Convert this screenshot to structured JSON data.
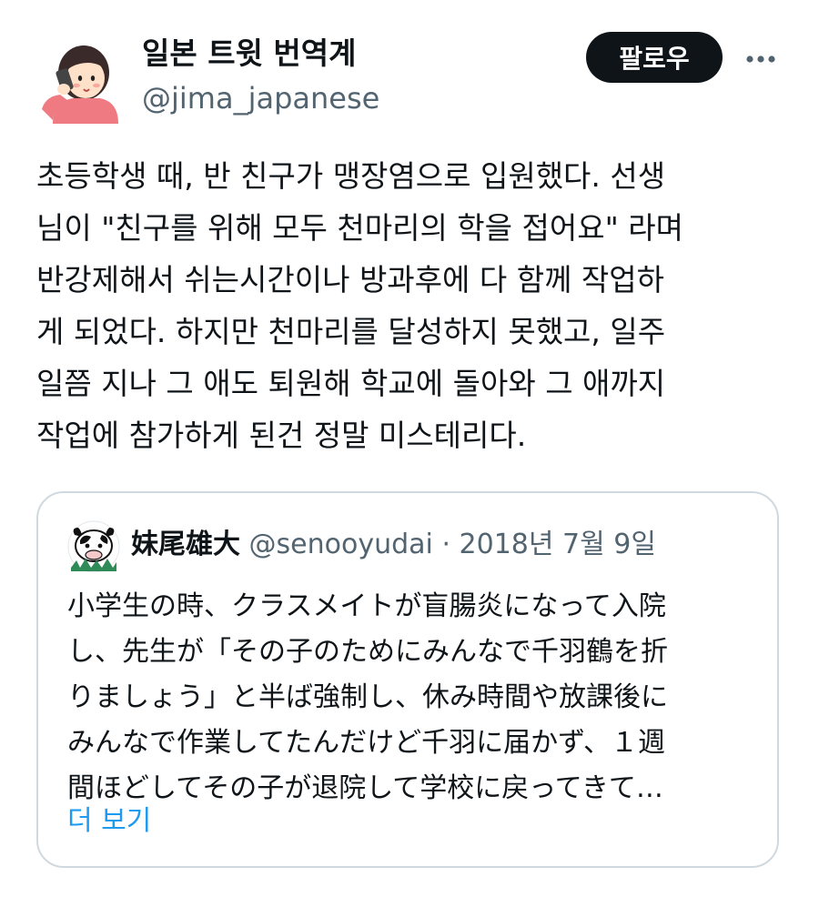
{
  "author": {
    "display_name": "일본 트윗 번역계",
    "handle": "@jima_japanese",
    "avatar_icon": "girl-on-phone-avatar"
  },
  "actions": {
    "follow_label": "팔로우",
    "more_icon": "more-dots-icon"
  },
  "tweet": {
    "lines": [
      "초등학생 때, 반 친구가 맹장염으로 입원했다. 선생",
      "님이 \"친구를 위해 모두 천마리의 학을 접어요\" 라며",
      "반강제해서 쉬는시간이나 방과후에 다 함께 작업하",
      "게 되었다. 하지만 천마리를 달성하지 못했고, 일주",
      "일쯤 지나 그 애도 퇴원해 학교에 돌아와 그 애까지",
      "작업에 참가하게 된건 정말 미스테리다."
    ]
  },
  "quote": {
    "display_name": "妹尾雄大",
    "handle": "@senooyudai",
    "separator": "·",
    "date": "2018년 7월 9일",
    "avatar_icon": "cartoon-cow-avatar",
    "lines": [
      "小学生の時、クラスメイトが盲腸炎になって入院",
      "し、先生が「その子のためにみんなで千羽鶴を折",
      "りましょう」と半ば強制し、休み時間や放課後に",
      "みんなで作業してたんだけど千羽に届かず、１週",
      "間ほどしてその子が退院して学校に戻ってきて…"
    ],
    "show_more": "더 보기"
  },
  "colors": {
    "text": "#0f1419",
    "secondary": "#536471",
    "link": "#1d9bf0",
    "border": "#cfd9de",
    "button_bg": "#0f1419"
  }
}
